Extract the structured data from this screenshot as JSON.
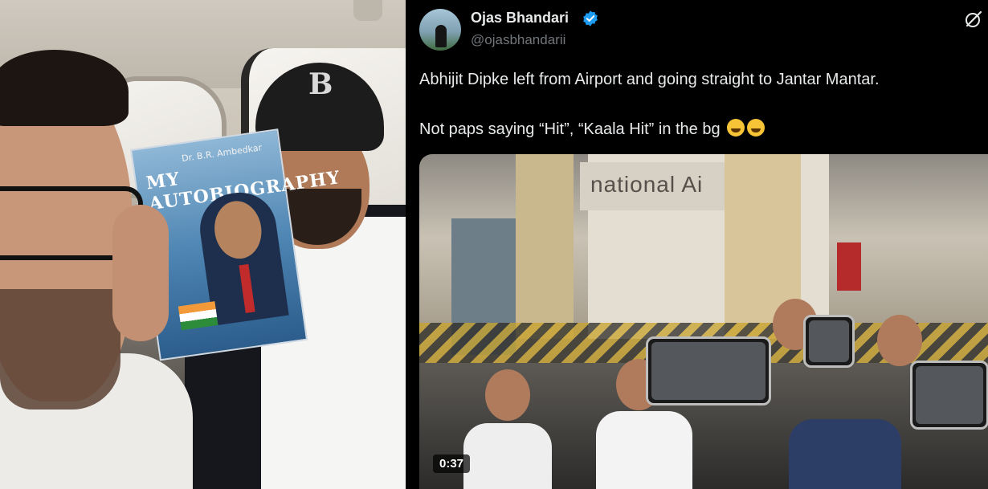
{
  "photo": {
    "book_author": "Dr. B.R. Ambedkar",
    "book_title": "MY AUTOBIOGRAPHY",
    "cap_letter": "B"
  },
  "tweet": {
    "author_name": "Ojas Bhandari",
    "author_handle": "@ojasbhandarii",
    "verified": true,
    "text_line1": "Abhijit Dipke left from Airport and going straight to Jantar Mantar.",
    "text_line2": "Not paps saying “Hit”, “Kaala Hit” in the bg",
    "emoji_count": 2,
    "video": {
      "building_sign": "national Ai",
      "duration": "0:37"
    },
    "icons": {
      "verified": "verified-badge-icon",
      "grok": "grok-icon",
      "emoji": "rolling-on-floor-laughing-emoji"
    },
    "colors": {
      "background": "#000000",
      "text": "#e7e9ea",
      "secondary_text": "#71767b",
      "verified_blue": "#1d9bf0"
    }
  }
}
